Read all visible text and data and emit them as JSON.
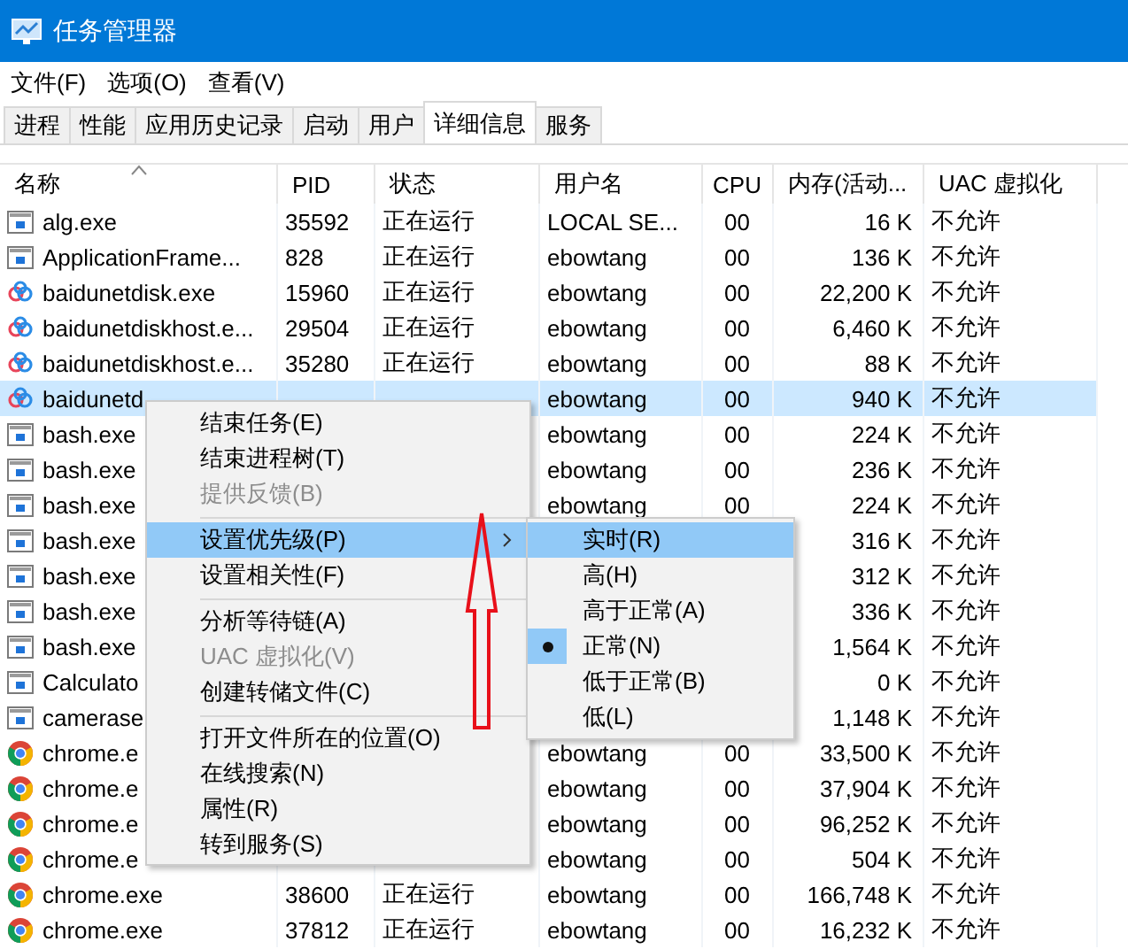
{
  "window": {
    "title": "任务管理器"
  },
  "menu_bar": [
    "文件(F)",
    "选项(O)",
    "查看(V)"
  ],
  "tabs": [
    {
      "label": "进程",
      "selected": false
    },
    {
      "label": "性能",
      "selected": false
    },
    {
      "label": "应用历史记录",
      "selected": false
    },
    {
      "label": "启动",
      "selected": false
    },
    {
      "label": "用户",
      "selected": false
    },
    {
      "label": "详细信息",
      "selected": true
    },
    {
      "label": "服务",
      "selected": false
    }
  ],
  "table": {
    "columns": [
      {
        "label": "名称",
        "sorted": true
      },
      {
        "label": "PID",
        "sorted": false
      },
      {
        "label": "状态",
        "sorted": false
      },
      {
        "label": "用户名",
        "sorted": false
      },
      {
        "label": "CPU",
        "sorted": false
      },
      {
        "label": "内存(活动...",
        "sorted": false
      },
      {
        "label": "UAC 虚拟化",
        "sorted": false
      }
    ],
    "rows": [
      {
        "kind": "window",
        "name": "alg.exe",
        "pid": "35592",
        "status": "正在运行",
        "user": "LOCAL SE...",
        "cpu": "00",
        "memory": "16 K",
        "uac": "不允许",
        "selected": false
      },
      {
        "kind": "window",
        "name": "ApplicationFrame...",
        "pid": "828",
        "status": "正在运行",
        "user": "ebowtang",
        "cpu": "00",
        "memory": "136 K",
        "uac": "不允许",
        "selected": false
      },
      {
        "kind": "cloud",
        "name": "baidunetdisk.exe",
        "pid": "15960",
        "status": "正在运行",
        "user": "ebowtang",
        "cpu": "00",
        "memory": "22,200 K",
        "uac": "不允许",
        "selected": false
      },
      {
        "kind": "cloud",
        "name": "baidunetdiskhost.e...",
        "pid": "29504",
        "status": "正在运行",
        "user": "ebowtang",
        "cpu": "00",
        "memory": "6,460 K",
        "uac": "不允许",
        "selected": false
      },
      {
        "kind": "cloud",
        "name": "baidunetdiskhost.e...",
        "pid": "35280",
        "status": "正在运行",
        "user": "ebowtang",
        "cpu": "00",
        "memory": "88 K",
        "uac": "不允许",
        "selected": false
      },
      {
        "kind": "cloud",
        "name": "baidunetd",
        "user": "ebowtang",
        "cpu": "00",
        "memory": "940 K",
        "uac": "不允许",
        "selected": true
      },
      {
        "kind": "window",
        "name": "bash.exe",
        "user": "ebowtang",
        "cpu": "00",
        "memory": "224 K",
        "uac": "不允许",
        "selected": false
      },
      {
        "kind": "window",
        "name": "bash.exe",
        "user": "ebowtang",
        "cpu": "00",
        "memory": "236 K",
        "uac": "不允许",
        "selected": false
      },
      {
        "kind": "window",
        "name": "bash.exe",
        "user": "ebowtang",
        "cpu": "00",
        "memory": "224 K",
        "uac": "不允许",
        "selected": false
      },
      {
        "kind": "window",
        "name": "bash.exe",
        "memory": "316 K",
        "uac": "不允许",
        "selected": false
      },
      {
        "kind": "window",
        "name": "bash.exe",
        "memory": "312 K",
        "uac": "不允许",
        "selected": false
      },
      {
        "kind": "window",
        "name": "bash.exe",
        "memory": "336 K",
        "uac": "不允许",
        "selected": false
      },
      {
        "kind": "window",
        "name": "bash.exe",
        "memory": "1,564 K",
        "uac": "不允许",
        "selected": false
      },
      {
        "kind": "window",
        "name": "Calculato",
        "memory": "0 K",
        "uac": "不允许",
        "selected": false
      },
      {
        "kind": "window",
        "name": "camerase",
        "memory": "1,148 K",
        "uac": "不允许",
        "selected": false
      },
      {
        "kind": "chrome",
        "name": "chrome.e",
        "user": "ebowtang",
        "cpu": "00",
        "memory": "33,500 K",
        "uac": "不允许",
        "selected": false
      },
      {
        "kind": "chrome",
        "name": "chrome.e",
        "user": "ebowtang",
        "cpu": "00",
        "memory": "37,904 K",
        "uac": "不允许",
        "selected": false
      },
      {
        "kind": "chrome",
        "name": "chrome.e",
        "user": "ebowtang",
        "cpu": "00",
        "memory": "96,252 K",
        "uac": "不允许",
        "selected": false
      },
      {
        "kind": "chrome",
        "name": "chrome.e",
        "user": "ebowtang",
        "cpu": "00",
        "memory": "504 K",
        "uac": "不允许",
        "selected": false
      },
      {
        "kind": "chrome",
        "name": "chrome.exe",
        "pid": "38600",
        "status": "正在运行",
        "user": "ebowtang",
        "cpu": "00",
        "memory": "166,748 K",
        "uac": "不允许",
        "selected": false
      },
      {
        "kind": "chrome",
        "name": "chrome.exe",
        "pid": "37812",
        "status": "正在运行",
        "user": "ebowtang",
        "cpu": "00",
        "memory": "16,232 K",
        "uac": "不允许",
        "selected": false
      }
    ]
  },
  "context_menu": {
    "items": [
      {
        "kind": "item",
        "label": "结束任务(E)",
        "disabled": false,
        "highlighted": false,
        "submenu": false
      },
      {
        "kind": "item",
        "label": "结束进程树(T)",
        "disabled": false,
        "highlighted": false,
        "submenu": false
      },
      {
        "kind": "item",
        "label": "提供反馈(B)",
        "disabled": true,
        "highlighted": false,
        "submenu": false
      },
      {
        "kind": "separator"
      },
      {
        "kind": "item",
        "label": "设置优先级(P)",
        "disabled": false,
        "highlighted": true,
        "submenu": true
      },
      {
        "kind": "item",
        "label": "设置相关性(F)",
        "disabled": false,
        "highlighted": false,
        "submenu": false
      },
      {
        "kind": "separator"
      },
      {
        "kind": "item",
        "label": "分析等待链(A)",
        "disabled": false,
        "highlighted": false,
        "submenu": false
      },
      {
        "kind": "item",
        "label": "UAC 虚拟化(V)",
        "disabled": true,
        "highlighted": false,
        "submenu": false
      },
      {
        "kind": "item",
        "label": "创建转储文件(C)",
        "disabled": false,
        "highlighted": false,
        "submenu": false
      },
      {
        "kind": "separator"
      },
      {
        "kind": "item",
        "label": "打开文件所在的位置(O)",
        "disabled": false,
        "highlighted": false,
        "submenu": false
      },
      {
        "kind": "item",
        "label": "在线搜索(N)",
        "disabled": false,
        "highlighted": false,
        "submenu": false
      },
      {
        "kind": "item",
        "label": "属性(R)",
        "disabled": false,
        "highlighted": false,
        "submenu": false
      },
      {
        "kind": "item",
        "label": "转到服务(S)",
        "disabled": false,
        "highlighted": false,
        "submenu": false
      }
    ]
  },
  "priority_submenu": {
    "items": [
      {
        "label": "实时(R)",
        "highlighted": true,
        "checked": false
      },
      {
        "label": "高(H)",
        "highlighted": false,
        "checked": false
      },
      {
        "label": "高于正常(A)",
        "highlighted": false,
        "checked": false
      },
      {
        "label": "正常(N)",
        "highlighted": false,
        "checked": true
      },
      {
        "label": "低于正常(B)",
        "highlighted": false,
        "checked": false
      },
      {
        "label": "低(L)",
        "highlighted": false,
        "checked": false
      }
    ]
  }
}
